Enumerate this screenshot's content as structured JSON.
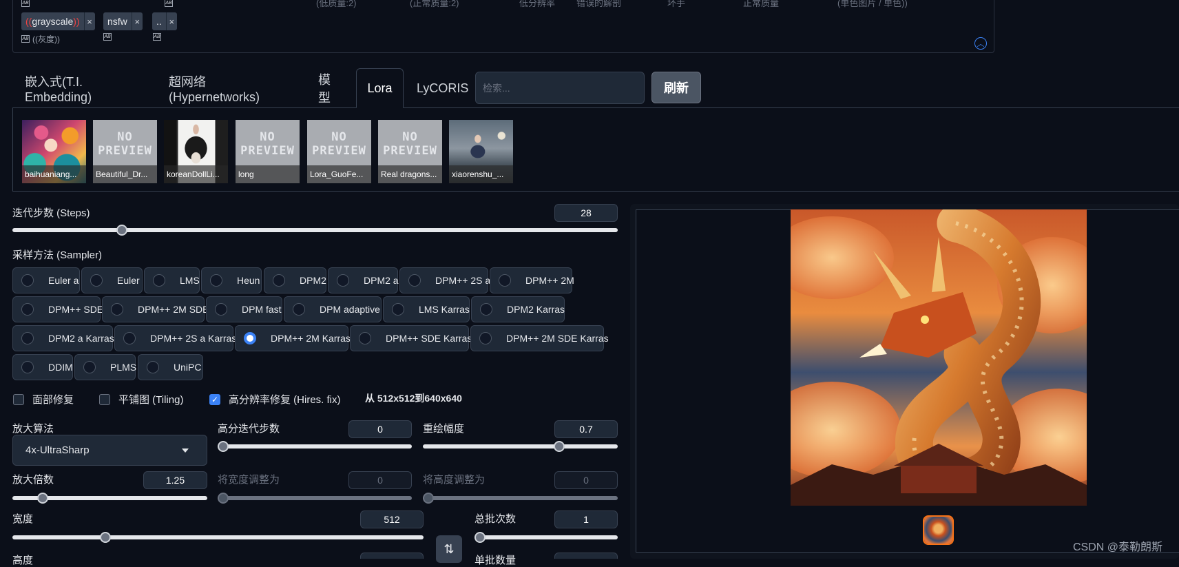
{
  "top_tags": {
    "ghost_labels": [
      "(低质量:2)",
      "(正常质量:2)",
      "低分辨率",
      "错误的解剖",
      "坏手",
      "正常质量",
      "(单色图片 / 单色))"
    ],
    "tags": [
      {
        "open": "((",
        "text": "grayscale",
        "close": "))",
        "sub": "((灰度))"
      },
      {
        "text": "nsfw",
        "sub": ""
      },
      {
        "text": "..",
        "sub": ""
      }
    ],
    "remove_glyph": "×",
    "ab_glyph": "AB",
    "collapse_glyph": "︿"
  },
  "tabs": [
    {
      "label": "嵌入式(T.I. Embedding)"
    },
    {
      "label": "超网络 (Hypernetworks)"
    },
    {
      "label": "模型"
    },
    {
      "label": "Lora"
    },
    {
      "label": "LyCORIS"
    }
  ],
  "active_tab": "Lora",
  "search": {
    "placeholder": "检索..."
  },
  "refresh_label": "刷新",
  "lora_cards": [
    {
      "name": "baihuaniang...",
      "preview": true
    },
    {
      "name": "Beautiful_Dr...",
      "preview": false
    },
    {
      "name": "koreanDollLi...",
      "preview": true
    },
    {
      "name": "long",
      "preview": false
    },
    {
      "name": "Lora_GuoFe...",
      "preview": false
    },
    {
      "name": "Real dragons...",
      "preview": false
    },
    {
      "name": "xiaorenshu_...",
      "preview": true
    }
  ],
  "no_preview_text": [
    "NO",
    "PREVIEW"
  ],
  "steps": {
    "label": "迭代步数 (Steps)",
    "value": "28",
    "min": 1,
    "max": 150
  },
  "sampler": {
    "label": "采样方法 (Sampler)",
    "options": [
      "Euler a",
      "Euler",
      "LMS",
      "Heun",
      "DPM2",
      "DPM2 a",
      "DPM++ 2S a",
      "DPM++ 2M",
      "DPM++ SDE",
      "DPM++ 2M SDE",
      "DPM fast",
      "DPM adaptive",
      "LMS Karras",
      "DPM2 Karras",
      "DPM2 a Karras",
      "DPM++ 2S a Karras",
      "DPM++ 2M Karras",
      "DPM++ SDE Karras",
      "DPM++ 2M SDE Karras",
      "DDIM",
      "PLMS",
      "UniPC"
    ],
    "selected": "DPM++ 2M Karras"
  },
  "checkboxes": [
    {
      "label": "面部修复",
      "checked": false
    },
    {
      "label": "平铺图 (Tiling)",
      "checked": false
    },
    {
      "label": "高分辨率修复 (Hires. fix)",
      "checked": true
    }
  ],
  "check_glyph": "✓",
  "hires_info": "从 512x512到640x640",
  "upscaler": {
    "label": "放大算法",
    "value": "4x-UltraSharp"
  },
  "hires_steps": {
    "label": "高分迭代步数",
    "value": "0",
    "max": 150
  },
  "denoise": {
    "label": "重绘幅度",
    "value": "0.7",
    "max": 1
  },
  "upscale_by": {
    "label": "放大倍数",
    "value": "1.25",
    "min": 1,
    "max": 4
  },
  "resize_w": {
    "label": "将宽度调整为",
    "value": "0"
  },
  "resize_h": {
    "label": "将高度调整为",
    "value": "0"
  },
  "width": {
    "label": "宽度",
    "value": "512",
    "min": 64,
    "max": 2048
  },
  "height": {
    "label": "高度"
  },
  "batch_count": {
    "label": "总批次数",
    "value": "1",
    "min": 1,
    "max": 100
  },
  "batch_size": {
    "label": "单批数量"
  },
  "swap_glyph": "⇅",
  "watermark": "CSDN @泰勒朗斯"
}
